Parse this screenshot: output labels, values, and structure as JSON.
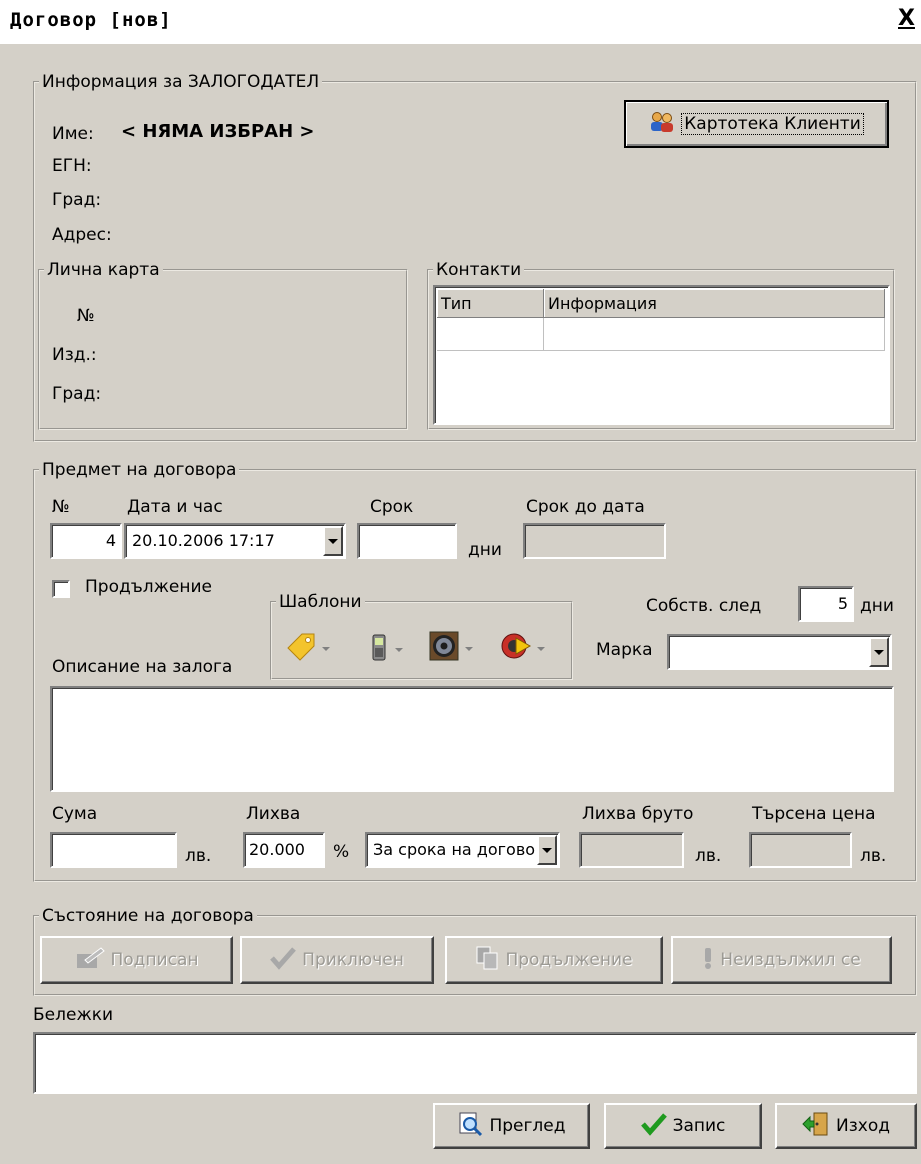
{
  "window": {
    "title": "Договор [нов]",
    "close_label": "X"
  },
  "pledger": {
    "legend": "Информация за ЗАЛОГОДАТЕЛ",
    "name_label": "Име:",
    "name_value": "< НЯМА ИЗБРАН >",
    "egn_label": "ЕГН:",
    "city_label": "Град:",
    "address_label": "Адрес:",
    "clients_button": "Картотека Клиенти",
    "id_card": {
      "legend": "Лична карта",
      "number_label": "№",
      "issued_label": "Изд.:",
      "city_label": "Град:"
    },
    "contacts": {
      "legend": "Контакти",
      "columns": [
        "Тип",
        "Информация"
      ]
    }
  },
  "subject": {
    "legend": "Предмет на договора",
    "number_label": "№",
    "number_value": "4",
    "datetime_label": "Дата и час",
    "datetime_value": "20.10.2006 17:17",
    "term_label": "Срок",
    "term_value": "",
    "days_unit": "дни",
    "term_date_label": "Срок до дата",
    "extension_checkbox_label": "Продължение",
    "extension_checked": false,
    "templates_legend": "Шаблони",
    "ownership_label": "Собств. след",
    "ownership_value": "5",
    "ownership_unit": "дни",
    "brand_label": "Марка",
    "brand_value": "",
    "description_label": "Описание на залога",
    "amount_label": "Сума",
    "amount_unit": "лв.",
    "interest_label": "Лихва",
    "interest_value": "20.000",
    "percent_sign": "%",
    "interest_period_value": "За срока на договора",
    "gross_interest_label": "Лихва бруто",
    "gross_unit": "лв.",
    "asked_price_label": "Търсена цена",
    "asked_unit": "лв."
  },
  "status": {
    "legend": "Състояние на договора",
    "signed": "Подписан",
    "closed": "Приключен",
    "extension": "Продължение",
    "defaulted": "Неиздължил се"
  },
  "notes": {
    "label": "Бележки",
    "value": ""
  },
  "footer": {
    "preview": "Преглед",
    "save": "Запис",
    "exit": "Изход"
  }
}
